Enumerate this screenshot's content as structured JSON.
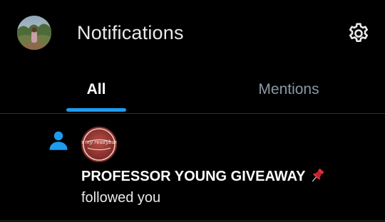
{
  "header": {
    "title": "Notifications",
    "avatar_icon": "profile-avatar",
    "settings_icon": "gear-icon"
  },
  "tabs": [
    {
      "label": "All",
      "active": true
    },
    {
      "label": "Mentions",
      "active": false
    }
  ],
  "notifications": [
    {
      "type_icon": "person-icon",
      "avatar_text": "oh my readybank",
      "name": "PROFESSOR YOUNG GIVEAWAY",
      "name_emoji": "pushpin-icon",
      "action": "followed you"
    }
  ],
  "colors": {
    "background": "#000000",
    "accent": "#1d9bf0",
    "text_primary": "#e7e9ea",
    "text_secondary": "#8b98a5",
    "divider": "#2f3336",
    "pin_red": "#e0333a"
  }
}
